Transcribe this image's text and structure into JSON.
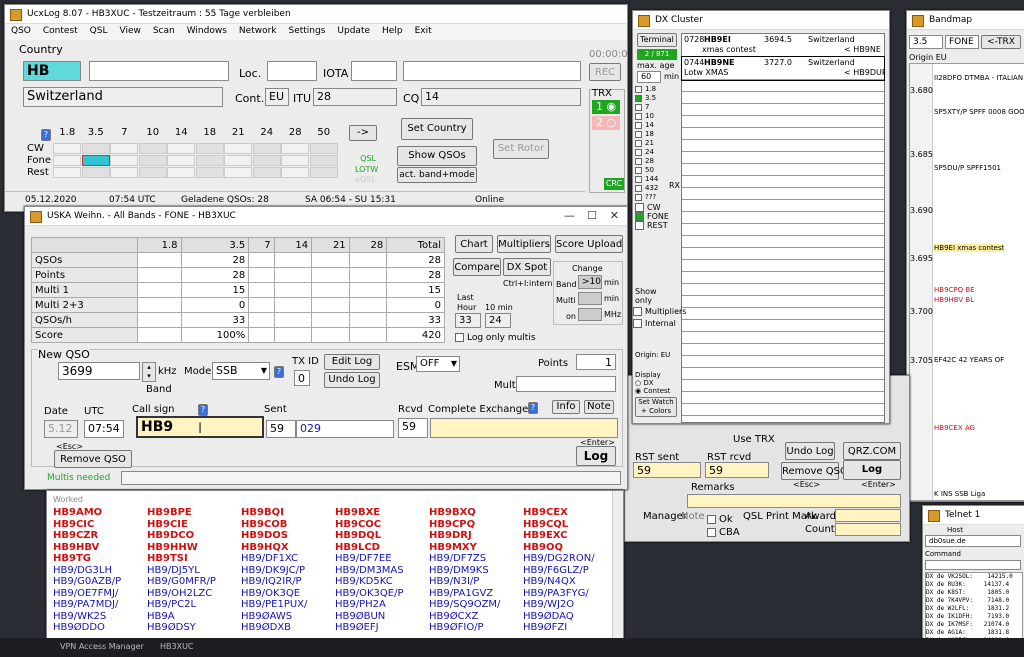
{
  "main": {
    "title": "UcxLog 8.07  -  HB3XUC  -  Testzeitraum : 55 Tage verbleiben",
    "menu": [
      "QSO",
      "Contest",
      "QSL",
      "View",
      "Scan",
      "Windows",
      "Network",
      "Settings",
      "Update",
      "Help",
      "Exit"
    ],
    "clock": "00:00:00",
    "country_label": "Country",
    "prefix": "HB",
    "country": "Switzerland",
    "loc_label": "Loc.",
    "iota_label": "IOTA",
    "rec_label": "REC",
    "cont_label": "Cont.",
    "cont_value": "EU",
    "itu_label": "ITU",
    "itu_value": "28",
    "cq_label": "CQ",
    "cq_value": "14",
    "trx_label": "TRX",
    "trx1": "1",
    "trx2": "2",
    "bands": [
      "1.8",
      "3.5",
      "7",
      "10",
      "14",
      "18",
      "21",
      "24",
      "28",
      "50"
    ],
    "band_help": "?",
    "modes": [
      "CW",
      "Fone",
      "Rest"
    ],
    "arrow_btn": "->",
    "set_country": "Set Country",
    "set_rotor": "Set Rotor",
    "show_qsos": "Show QSOs",
    "act_band_mode": "act. band+mode",
    "qsl": "QSL",
    "lotw": "LOTW",
    "eqsl": "eQSL",
    "crc": "CRC",
    "status": [
      "05.12.2020",
      "07:54 UTC",
      "Geladene QSOs: 28",
      "SA 06:54 - SU 15:31",
      "Online"
    ]
  },
  "contest": {
    "title": "USKA Weihn. - All Bands - FONE  -  HB3XUC",
    "headers": [
      "",
      "1.8",
      "3.5",
      "7",
      "14",
      "21",
      "28",
      "Total"
    ],
    "rows": [
      [
        "QSOs",
        "",
        "28",
        "",
        "",
        "",
        "",
        "28"
      ],
      [
        "Points",
        "",
        "28",
        "",
        "",
        "",
        "",
        "28"
      ],
      [
        "Multi 1",
        "",
        "15",
        "",
        "",
        "",
        "",
        "15"
      ],
      [
        "Multi 2+3",
        "",
        "0",
        "",
        "",
        "",
        "",
        "0"
      ],
      [
        "QSOs/h",
        "",
        "33",
        "",
        "",
        "",
        "",
        "33"
      ],
      [
        "Score",
        "",
        "100%",
        "",
        "",
        "",
        "",
        "420"
      ]
    ],
    "chart_btn": "Chart",
    "multipliers_btn": "Multipliers",
    "score_upload_btn": "Score Upload",
    "compare_btn": "Compare",
    "dx_spot_btn": "DX Spot",
    "ctrl_hint": "Ctrl+I:intern",
    "change_label": "Change",
    "band_label": "Band",
    "band_change": ">10",
    "min": "min",
    "multi_label": "Multi",
    "on_label": "on",
    "mhz": "MHz",
    "last_hour": "Last",
    "hour": "Hour",
    "ten_min": "10 min",
    "last_hour_val": "33",
    "ten_min_val": "24",
    "log_only_multis": "Log only multis",
    "new_qso": "New QSO",
    "freq": "3699",
    "khz": "kHz",
    "band_word": "Band",
    "mode_label": "Mode",
    "mode": "SSB",
    "txid_label": "TX ID",
    "txid": "0",
    "edit_log": "Edit Log",
    "undo_log": "Undo Log",
    "esm_label": "ESM",
    "esm": "OFF",
    "points_label": "Points",
    "points": "1",
    "multi_label2": "Multi",
    "date_label": "Date",
    "utc_label": "UTC",
    "callsign_label": "Call sign",
    "sent_label": "Sent",
    "rcvd_label": "Rcvd",
    "exchange_label": "Complete Exchange",
    "info_btn": "Info",
    "note_btn": "Note",
    "date": "5.12",
    "utc": "07:54",
    "callsign": "HB9",
    "sent_rst": "59",
    "sent_nr": "029",
    "rcvd": "59",
    "esc": "<Esc>",
    "enter": "<Enter>",
    "remove_qso": "Remove QSO",
    "log_btn": "Log",
    "multis_needed": "Multis needed",
    "help": "?"
  },
  "worked": {
    "label": "Worked",
    "columns": [
      [
        {
          "c": "HB9AMO",
          "t": "red"
        },
        {
          "c": "HB9CIC",
          "t": "red"
        },
        {
          "c": "HB9CZR",
          "t": "red"
        },
        {
          "c": "HB9HBV",
          "t": "red"
        },
        {
          "c": "HB9TG",
          "t": "red"
        },
        {
          "c": "HB9/DG3LH",
          "t": "blue"
        },
        {
          "c": "HB9/G0AZB/P",
          "t": "blue"
        },
        {
          "c": "HB9/OE7FMJ/",
          "t": "blue"
        },
        {
          "c": "HB9/PA7MDJ/",
          "t": "blue"
        },
        {
          "c": "HB9/WK2S",
          "t": "blue"
        },
        {
          "c": "HB9ØDDO",
          "t": "blue"
        }
      ],
      [
        {
          "c": "HB9BPE",
          "t": "red"
        },
        {
          "c": "HB9CIE",
          "t": "red"
        },
        {
          "c": "HB9DCO",
          "t": "red"
        },
        {
          "c": "HB9HHW",
          "t": "red"
        },
        {
          "c": "HB9TSI",
          "t": "red"
        },
        {
          "c": "HB9/DJ5YL",
          "t": "blue"
        },
        {
          "c": "HB9/G0MFR/P",
          "t": "blue"
        },
        {
          "c": "HB9/OH2LZC",
          "t": "blue"
        },
        {
          "c": "HB9/PC2L",
          "t": "blue"
        },
        {
          "c": "HB9A",
          "t": "blue"
        },
        {
          "c": "HB9ØDSY",
          "t": "blue"
        }
      ],
      [
        {
          "c": "HB9BQI",
          "t": "red"
        },
        {
          "c": "HB9COB",
          "t": "red"
        },
        {
          "c": "HB9DOS",
          "t": "red"
        },
        {
          "c": "HB9HQX",
          "t": "red"
        },
        {
          "c": "HB9/DF1XC",
          "t": "blue"
        },
        {
          "c": "HB9/DK9JC/P",
          "t": "blue"
        },
        {
          "c": "HB9/IQ2IR/P",
          "t": "blue"
        },
        {
          "c": "HB9/OK3QE",
          "t": "blue"
        },
        {
          "c": "HB9/PE1PUX/",
          "t": "blue"
        },
        {
          "c": "HB9ØAWS",
          "t": "blue"
        },
        {
          "c": "HB9ØDXB",
          "t": "blue"
        }
      ],
      [
        {
          "c": "HB9BXE",
          "t": "red"
        },
        {
          "c": "HB9COC",
          "t": "red"
        },
        {
          "c": "HB9DQL",
          "t": "red"
        },
        {
          "c": "HB9LCD",
          "t": "red"
        },
        {
          "c": "HB9/DF7EE",
          "t": "blue"
        },
        {
          "c": "HB9/DM3MAS",
          "t": "blue"
        },
        {
          "c": "HB9/KD5KC",
          "t": "blue"
        },
        {
          "c": "HB9/OK3QE/P",
          "t": "blue"
        },
        {
          "c": "HB9/PH2A",
          "t": "blue"
        },
        {
          "c": "HB9ØBUN",
          "t": "blue"
        },
        {
          "c": "HB9ØEFJ",
          "t": "blue"
        }
      ],
      [
        {
          "c": "HB9BXQ",
          "t": "red"
        },
        {
          "c": "HB9CPQ",
          "t": "red"
        },
        {
          "c": "HB9DRJ",
          "t": "red"
        },
        {
          "c": "HB9MXY",
          "t": "red"
        },
        {
          "c": "HB9/DF7ZS",
          "t": "blue"
        },
        {
          "c": "HB9/DM9KS",
          "t": "blue"
        },
        {
          "c": "HB9/N3I/P",
          "t": "blue"
        },
        {
          "c": "HB9/PA1GVZ",
          "t": "blue"
        },
        {
          "c": "HB9/SQ9OZM/",
          "t": "blue"
        },
        {
          "c": "HB9ØCXZ",
          "t": "blue"
        },
        {
          "c": "HB9ØFIO/P",
          "t": "blue"
        }
      ],
      [
        {
          "c": "HB9CEX",
          "t": "red"
        },
        {
          "c": "HB9CQL",
          "t": "red"
        },
        {
          "c": "HB9EXC",
          "t": "red"
        },
        {
          "c": "HB9OQ",
          "t": "red"
        },
        {
          "c": "HB9/DG2RON/",
          "t": "blue"
        },
        {
          "c": "HB9/F6GLZ/P",
          "t": "blue"
        },
        {
          "c": "HB9/N4QX",
          "t": "blue"
        },
        {
          "c": "HB9/PA3FYG/",
          "t": "blue"
        },
        {
          "c": "HB9/WJ2O",
          "t": "blue"
        },
        {
          "c": "HB9ØDAQ",
          "t": "blue"
        },
        {
          "c": "HB9ØFZI",
          "t": "blue"
        }
      ]
    ]
  },
  "dxcluster": {
    "title": "DX Cluster",
    "terminal": "Terminal",
    "count": "2 / 871",
    "max_age_label": "max. age",
    "max_age": "60",
    "min": "min",
    "bands": [
      "1.8",
      "3.5",
      "7",
      "10",
      "14",
      "18",
      "21",
      "24",
      "28",
      "50",
      "144",
      "432",
      "???"
    ],
    "modes": [
      "CW",
      "FONE",
      "REST"
    ],
    "rx": "RX",
    "spots": [
      {
        "time": "0728",
        "call": "HB9EI",
        "freq": "3694.5",
        "country": "Switzerland",
        "spotter": "< HB9NE",
        "comment": "xmas contest"
      },
      {
        "time": "0744",
        "call": "HB9NE",
        "freq": "3727.0",
        "country": "Switzerland",
        "spotter": "< HB9DUR",
        "comment": "Lotw XMAS"
      }
    ],
    "show_only": "Show only",
    "multipliers": "Multipliers",
    "internal": "Internal",
    "origin": "Origin: EU",
    "display": "Display",
    "dx": "DX",
    "contest": "Contest",
    "set_watch": "Set Watch + Colors"
  },
  "bandmap": {
    "title": "Bandmap",
    "band": "3.5",
    "mode": "FONE",
    "trx": "<-TRX",
    "origin": "Origin EU",
    "freqs": [
      "3.680",
      "3.685",
      "3.690",
      "3.695",
      "3.700",
      "3.705"
    ],
    "entries": [
      {
        "call": "II28DFO",
        "info": "DTMBA - ITALIAN"
      },
      {
        "call": "SP5XTY/P",
        "info": "SPFF 0008 GOO"
      },
      {
        "call": "SP5DU/P",
        "info": "SPFF1501"
      },
      {
        "call": "HB9EI",
        "info": "xmas contest"
      },
      {
        "call": "HB9CPQ",
        "info": "BE"
      },
      {
        "call": "HB9HBV",
        "info": "BL"
      },
      {
        "call": "EF42C",
        "info": "42 YEARS OF"
      },
      {
        "call": "HB9CEX",
        "info": "AG"
      },
      {
        "call": "K INS",
        "info": "SSB Liga"
      }
    ]
  },
  "qsopanel": {
    "use_trx": "Use TRX",
    "undo_log": "Undo Log",
    "qrz": "QRZ.COM",
    "rst_sent": "RST sent",
    "rst_rcvd": "RST rcvd",
    "rst_sent_val": "59",
    "rst_rcvd_val": "59",
    "remove_qso": "Remove QSO",
    "log": "Log",
    "esc": "<Esc>",
    "enter": "<Enter>",
    "remarks": "Remarks",
    "manager": "Manager",
    "note": "Note",
    "qsl_print": "QSL Print Mark",
    "ok": "Ok",
    "cba": "CBA",
    "award": "Award",
    "count": "Count"
  },
  "telnet": {
    "title": "Telnet 1",
    "host_label": "Host",
    "host": "db0sue.de",
    "command_label": "Command",
    "lines": [
      "DX de VK2SOL:    14215.0",
      "DX de RU3K:     14137.4",
      "DX de K8ST:      1805.0",
      "DX de 7K4VPV:    7148.0",
      "DX de W2LFL:     1831.2",
      "DX de IK1DFH:    7193.0",
      "DX de IK7MSF:   21074.0",
      "DX de AG1A:      1831.8",
      "DX de HA3RCL:   14010.0",
      "DX de KA5FI:     3740.0"
    ]
  },
  "taskbar": {
    "item1": "VPN Access Manager",
    "item2": "HB3XUC"
  },
  "colors": {
    "worked_new": "#d01010",
    "worked_dupe": "#1414b4",
    "green": "#1fa51f",
    "callsign_bg": "#fff4c2",
    "prefix_bg": "#5fd9d9"
  }
}
